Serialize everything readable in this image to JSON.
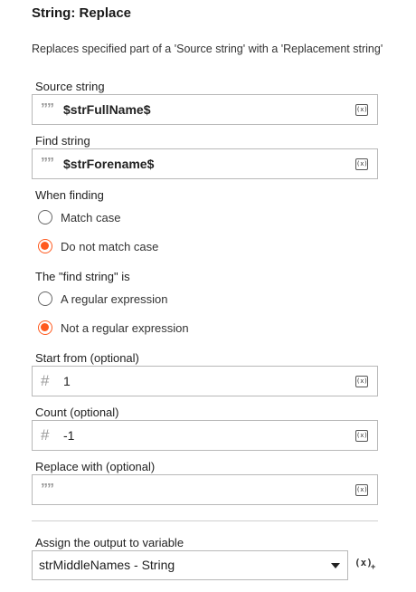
{
  "title": "String: Replace",
  "description": "Replaces specified part of a 'Source string' with a 'Replacement string'",
  "source_string": {
    "label": "Source string",
    "prefix_icon": "string-quote-icon",
    "value": "$strFullName$",
    "var_button": "(x)"
  },
  "find_string": {
    "label": "Find string",
    "prefix_icon": "string-quote-icon",
    "value": "$strForename$",
    "var_button": "(x)"
  },
  "when_finding": {
    "label": "When finding",
    "options": [
      {
        "label": "Match case",
        "selected": false
      },
      {
        "label": "Do not match case",
        "selected": true
      }
    ]
  },
  "find_is": {
    "label": "The \"find string\" is",
    "options": [
      {
        "label": "A regular expression",
        "selected": false
      },
      {
        "label": "Not a regular expression",
        "selected": true
      }
    ]
  },
  "start_from": {
    "label": "Start from (optional)",
    "prefix_icon": "hash-icon",
    "prefix": "#",
    "value": "1",
    "var_button": "(x)"
  },
  "count": {
    "label": "Count (optional)",
    "prefix_icon": "hash-icon",
    "prefix": "#",
    "value": "-1",
    "var_button": "(x)"
  },
  "replace_with": {
    "label": "Replace with (optional)",
    "prefix_icon": "string-quote-icon",
    "value": "",
    "var_button": "(x)"
  },
  "output": {
    "label": "Assign the output to variable",
    "selected": "strMiddleNames - String",
    "new_var_button": "(x)",
    "new_var_plus": "+"
  },
  "colors": {
    "accent": "#ff5a1f",
    "border": "#b8b8b8"
  }
}
